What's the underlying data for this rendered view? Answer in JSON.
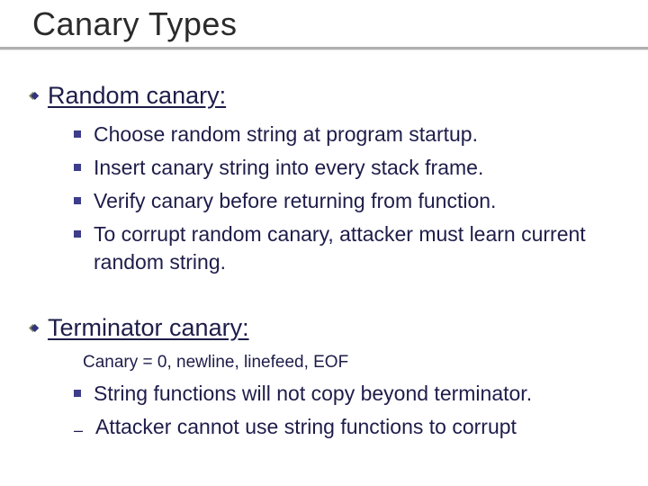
{
  "title": "Canary Types",
  "sections": [
    {
      "heading": "Random canary:",
      "items": [
        "Choose random string at program startup.",
        "Insert canary string into every stack frame.",
        "Verify canary before returning from function.",
        "To corrupt random canary, attacker must learn current random string."
      ]
    },
    {
      "heading": "Terminator canary:",
      "code": "Canary  =  0, newline, linefeed, EOF",
      "items": [
        "String functions will not copy beyond terminator."
      ],
      "partial": "Attacker cannot use string functions to corrupt"
    }
  ]
}
